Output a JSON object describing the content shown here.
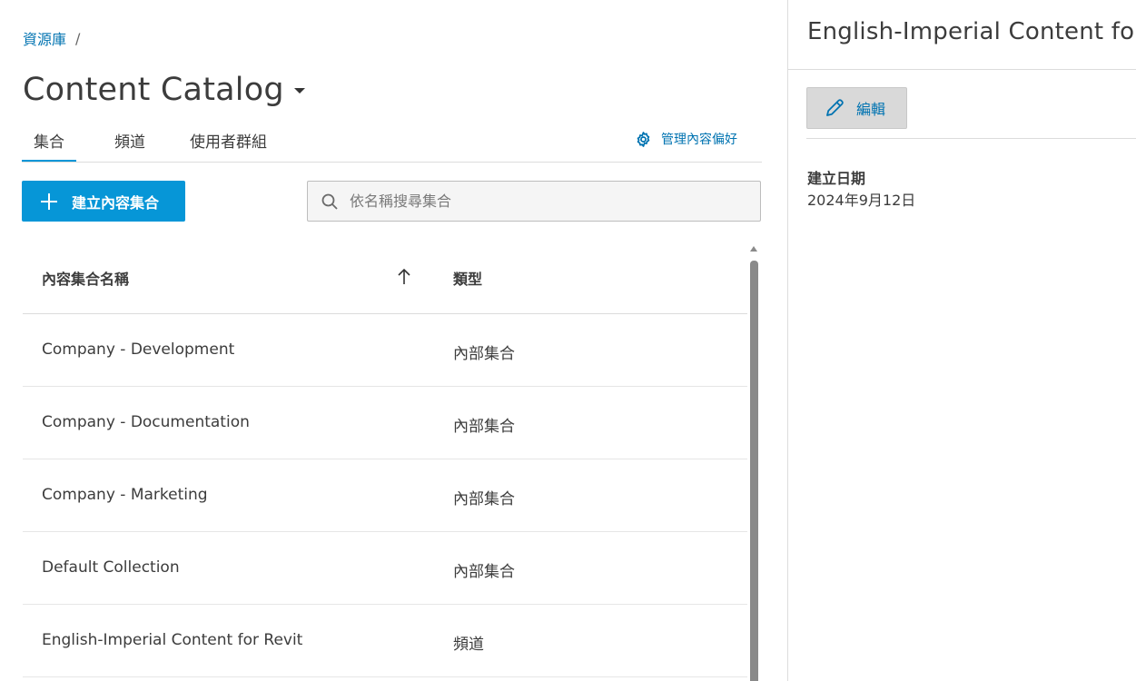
{
  "breadcrumb": {
    "root": "資源庫",
    "separator": "/"
  },
  "page": {
    "title": "Content Catalog"
  },
  "tabs": [
    {
      "label": "集合",
      "active": true
    },
    {
      "label": "頻道",
      "active": false
    },
    {
      "label": "使用者群組",
      "active": false
    }
  ],
  "manage_link": {
    "label": "管理內容偏好",
    "icon": "gear-icon"
  },
  "create_button": {
    "label": "建立內容集合",
    "icon": "plus-icon"
  },
  "search": {
    "placeholder": "依名稱搜尋集合",
    "value": "",
    "icon": "search-icon"
  },
  "table": {
    "columns": {
      "name": "內容集合名稱",
      "type": "類型",
      "sort_icon": "arrow-up-icon"
    },
    "rows": [
      {
        "name": "Company - Development",
        "type": "內部集合"
      },
      {
        "name": "Company - Documentation",
        "type": "內部集合"
      },
      {
        "name": "Company - Marketing",
        "type": "內部集合"
      },
      {
        "name": "Default Collection",
        "type": "內部集合"
      },
      {
        "name": "English-Imperial Content for Revit",
        "type": "頻道"
      }
    ]
  },
  "detail": {
    "title": "English-Imperial Content for Revit",
    "edit_label": "編輯",
    "edit_icon": "pencil-icon",
    "created_label": "建立日期",
    "created_value": "2024年9月12日"
  },
  "colors": {
    "accent": "#0696d7",
    "link": "#0073b1",
    "text": "#3c3c3c"
  }
}
